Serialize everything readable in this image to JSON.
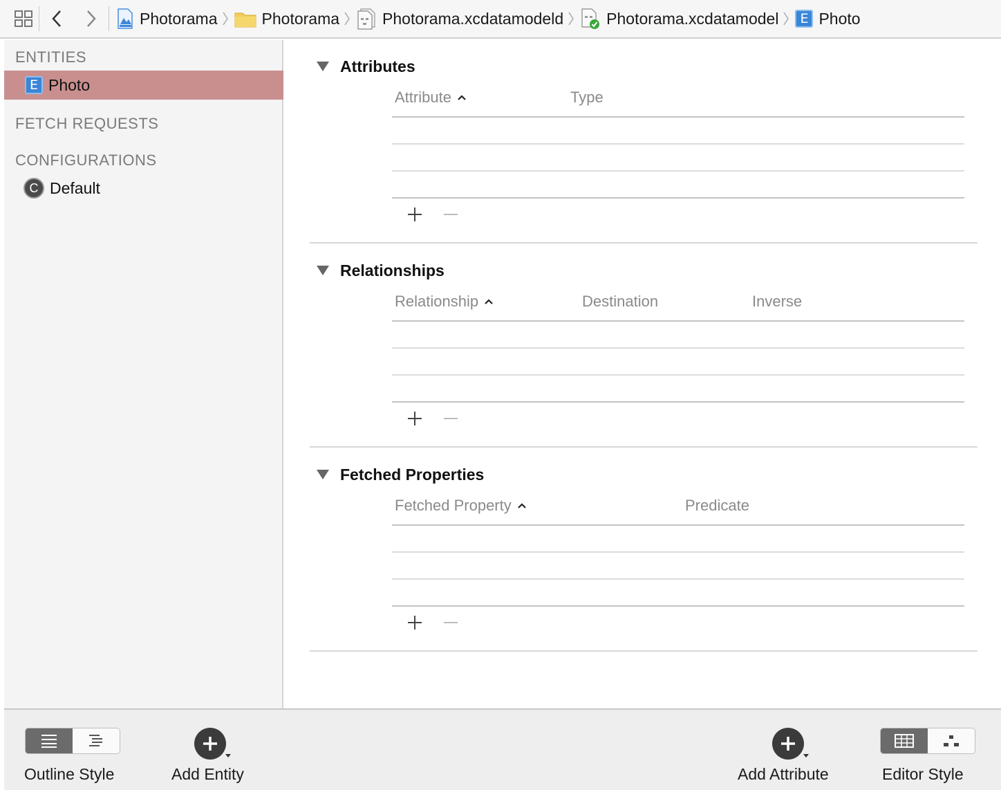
{
  "jumpbar": {
    "grid_icon": "related-items-icon",
    "back_icon": "chevron-left-icon",
    "forward_icon": "chevron-right-icon",
    "crumbs": [
      {
        "label": "Photorama",
        "icon": "project-icon"
      },
      {
        "label": "Photorama",
        "icon": "folder-icon"
      },
      {
        "label": "Photorama.xcdatamodeld",
        "icon": "datamodel-bundle-icon"
      },
      {
        "label": "Photorama.xcdatamodel",
        "icon": "datamodel-icon"
      },
      {
        "label": "Photo",
        "icon": "entity-icon"
      }
    ]
  },
  "sidebar": {
    "entities_heading": "ENTITIES",
    "entities": [
      {
        "label": "Photo",
        "badge": "E",
        "selected": true
      }
    ],
    "fetch_heading": "FETCH REQUESTS",
    "config_heading": "CONFIGURATIONS",
    "configurations": [
      {
        "label": "Default",
        "badge": "C"
      }
    ]
  },
  "main": {
    "attributes": {
      "title": "Attributes",
      "columns": [
        "Attribute",
        "Type"
      ]
    },
    "relationships": {
      "title": "Relationships",
      "columns": [
        "Relationship",
        "Destination",
        "Inverse"
      ]
    },
    "fetched": {
      "title": "Fetched Properties",
      "columns": [
        "Fetched Property",
        "Predicate"
      ]
    }
  },
  "bottombar": {
    "outline_style_label": "Outline Style",
    "add_entity_label": "Add Entity",
    "add_attribute_label": "Add Attribute",
    "editor_style_label": "Editor Style"
  },
  "colors": {
    "selection": "#c98f8f",
    "entity_badge": "#3a86d6",
    "segment_on": "#6b6b6b"
  }
}
